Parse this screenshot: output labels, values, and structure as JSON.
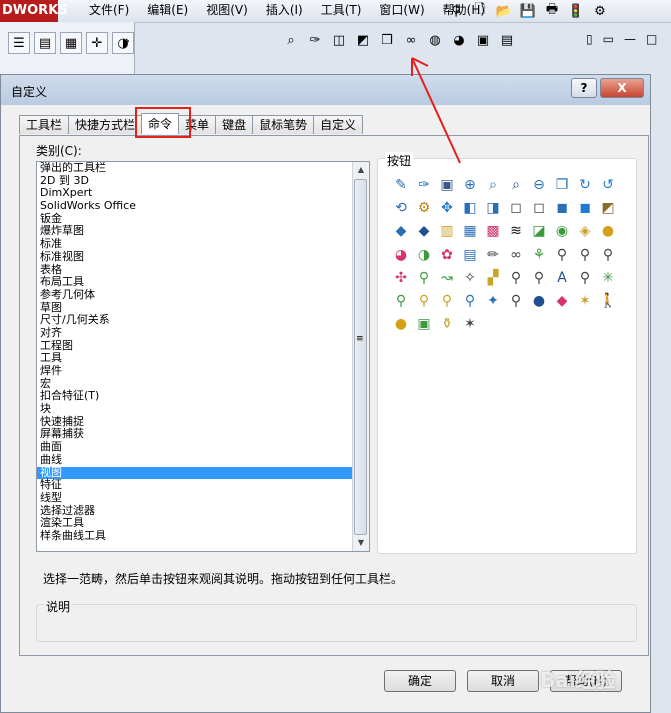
{
  "app": {
    "logo_text": "DWORKS",
    "menus": [
      "文件(F)",
      "编辑(E)",
      "视图(V)",
      "插入(I)",
      "工具(T)",
      "窗口(W)",
      "帮助(H)"
    ],
    "quick_icons": [
      "pin-icon",
      "new-doc-icon",
      "open-folder-icon",
      "save-icon",
      "print-icon",
      "traffic-light-icon",
      "options-icon"
    ],
    "left_tools": [
      "tree-icon",
      "property-icon",
      "config-icon",
      "dim-icon",
      "appearance-icon"
    ],
    "view_icons": [
      "zoom-fit-icon",
      "zoom-area-icon",
      "previous-view-icon",
      "section-view-icon",
      "view-orient-icon",
      "display-style-icon",
      "hide-show-icon",
      "edit-appearance-icon",
      "scene-icon",
      "view-settings-icon"
    ]
  },
  "dialog": {
    "title": "自定义",
    "help_label": "?",
    "close_label": "X",
    "tabs": [
      "工具栏",
      "快捷方式栏",
      "命令",
      "菜单",
      "键盘",
      "鼠标笔势",
      "自定义"
    ],
    "active_tab": "命令",
    "category_label": "类别(C):",
    "categories": [
      "弹出的工具栏",
      "2D 到 3D",
      "DimXpert",
      "SolidWorks Office",
      "钣金",
      "爆炸草图",
      "标准",
      "标准视图",
      "表格",
      "布局工具",
      "参考几何体",
      "草图",
      "尺寸/几何关系",
      "对齐",
      "工程图",
      "工具",
      "焊件",
      "宏",
      "扣合特征(T)",
      "块",
      "快速捕捉",
      "屏幕捕获",
      "曲面",
      "曲线",
      "视图",
      "特征",
      "线型",
      "选择过滤器",
      "渲染工具",
      "样条曲线工具"
    ],
    "selected_category": "视图",
    "buttons_label": "按钮",
    "hint": "选择一范畴，然后单击按钮来观阅其说明。拖动按钮到任何工具栏。",
    "description_label": "说明",
    "ok_label": "确定",
    "cancel_label": "取消",
    "help_button_label": "帮助(H)"
  },
  "command_icons": [
    {
      "glyph": "✎",
      "color": "#2a6fb5"
    },
    {
      "glyph": "✑",
      "color": "#2a6fb5"
    },
    {
      "glyph": "▣",
      "color": "#3a5a8c"
    },
    {
      "glyph": "⊕",
      "color": "#2a6fb5"
    },
    {
      "glyph": "⌕",
      "color": "#2a6fb5"
    },
    {
      "glyph": "⌕",
      "color": "#1f4f8f"
    },
    {
      "glyph": "⊖",
      "color": "#2a6fb5"
    },
    {
      "glyph": "❐",
      "color": "#2a6fb5"
    },
    {
      "glyph": "↻",
      "color": "#1f7bd1"
    },
    {
      "glyph": "↺",
      "color": "#1f7bd1"
    },
    {
      "glyph": "⟲",
      "color": "#2a6fb5"
    },
    {
      "glyph": "⚙",
      "color": "#b8860b"
    },
    {
      "glyph": "✥",
      "color": "#1f7bd1"
    },
    {
      "glyph": "◧",
      "color": "#2a6fb5"
    },
    {
      "glyph": "◨",
      "color": "#2a6fb5"
    },
    {
      "glyph": "◻",
      "color": "#444444"
    },
    {
      "glyph": "◻",
      "color": "#444444"
    },
    {
      "glyph": "◼",
      "color": "#2a6fb5"
    },
    {
      "glyph": "◼",
      "color": "#1f7bd1"
    },
    {
      "glyph": "◩",
      "color": "#8a6d2a"
    },
    {
      "glyph": "◆",
      "color": "#2a6fb5"
    },
    {
      "glyph": "◆",
      "color": "#1f4f8f"
    },
    {
      "glyph": "▥",
      "color": "#c9a227"
    },
    {
      "glyph": "▦",
      "color": "#2a6fb5"
    },
    {
      "glyph": "▩",
      "color": "#d6336c"
    },
    {
      "glyph": "≋",
      "color": "#111111"
    },
    {
      "glyph": "◪",
      "color": "#3c9a3c"
    },
    {
      "glyph": "◉",
      "color": "#3c9a3c"
    },
    {
      "glyph": "◈",
      "color": "#c9a227"
    },
    {
      "glyph": "●",
      "color": "#d4a017"
    },
    {
      "glyph": "◕",
      "color": "#d6336c"
    },
    {
      "glyph": "◑",
      "color": "#3c9a3c"
    },
    {
      "glyph": "✿",
      "color": "#d6336c"
    },
    {
      "glyph": "▤",
      "color": "#2a6fb5"
    },
    {
      "glyph": "✏",
      "color": "#444444"
    },
    {
      "glyph": "∞",
      "color": "#444444"
    },
    {
      "glyph": "⚘",
      "color": "#3c9a3c"
    },
    {
      "glyph": "⚲",
      "color": "#444444"
    },
    {
      "glyph": "⚲",
      "color": "#444444"
    },
    {
      "glyph": "⚲",
      "color": "#444444"
    },
    {
      "glyph": "✣",
      "color": "#d6336c"
    },
    {
      "glyph": "⚲",
      "color": "#3c9a3c"
    },
    {
      "glyph": "↝",
      "color": "#3c9a3c"
    },
    {
      "glyph": "✧",
      "color": "#444444"
    },
    {
      "glyph": "▞",
      "color": "#c9a227"
    },
    {
      "glyph": "⚲",
      "color": "#444444"
    },
    {
      "glyph": "⚲",
      "color": "#444444"
    },
    {
      "glyph": "A",
      "color": "#1f4f8f"
    },
    {
      "glyph": "⚲",
      "color": "#444444"
    },
    {
      "glyph": "✳",
      "color": "#3c9a3c"
    },
    {
      "glyph": "⚲",
      "color": "#3c9a3c"
    },
    {
      "glyph": "⚲",
      "color": "#c9a227"
    },
    {
      "glyph": "⚲",
      "color": "#c9a227"
    },
    {
      "glyph": "⚲",
      "color": "#2a6fb5"
    },
    {
      "glyph": "✦",
      "color": "#2a6fb5"
    },
    {
      "glyph": "⚲",
      "color": "#444444"
    },
    {
      "glyph": "●",
      "color": "#1f4f8f"
    },
    {
      "glyph": "◆",
      "color": "#d6336c"
    },
    {
      "glyph": "✶",
      "color": "#c9a227"
    },
    {
      "glyph": "🚶",
      "color": "#d6336c"
    },
    {
      "glyph": "●",
      "color": "#d4a017"
    },
    {
      "glyph": "▣",
      "color": "#3c9a3c"
    },
    {
      "glyph": "⚱",
      "color": "#c9a227"
    },
    {
      "glyph": "✶",
      "color": "#444444"
    }
  ],
  "watermark": "Bai经验"
}
